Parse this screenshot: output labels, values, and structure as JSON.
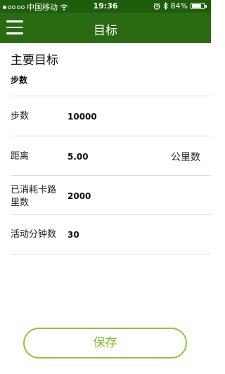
{
  "status_bar": {
    "carrier": "中国移动",
    "time": "19:36",
    "battery": "84%",
    "battery_level": 0.84
  },
  "nav": {
    "title": "目标",
    "menu_icon": "hamburger-menu-icon"
  },
  "section": {
    "title": "主要目标",
    "subtitle": "步数"
  },
  "rows": [
    {
      "label": "步数",
      "value": "10000",
      "unit": ""
    },
    {
      "label": "距离",
      "value": "5.00",
      "unit": "公里数"
    },
    {
      "label": "已消耗卡路里数",
      "value": "2000",
      "unit": ""
    },
    {
      "label": "活动分钟数",
      "value": "30",
      "unit": ""
    }
  ],
  "save_label": "保存",
  "colors": {
    "statusbar": "#1f5d0c",
    "navbar": "#2a6a12",
    "button_border": "#8dc63f",
    "button_text": "#7dbb2e"
  }
}
